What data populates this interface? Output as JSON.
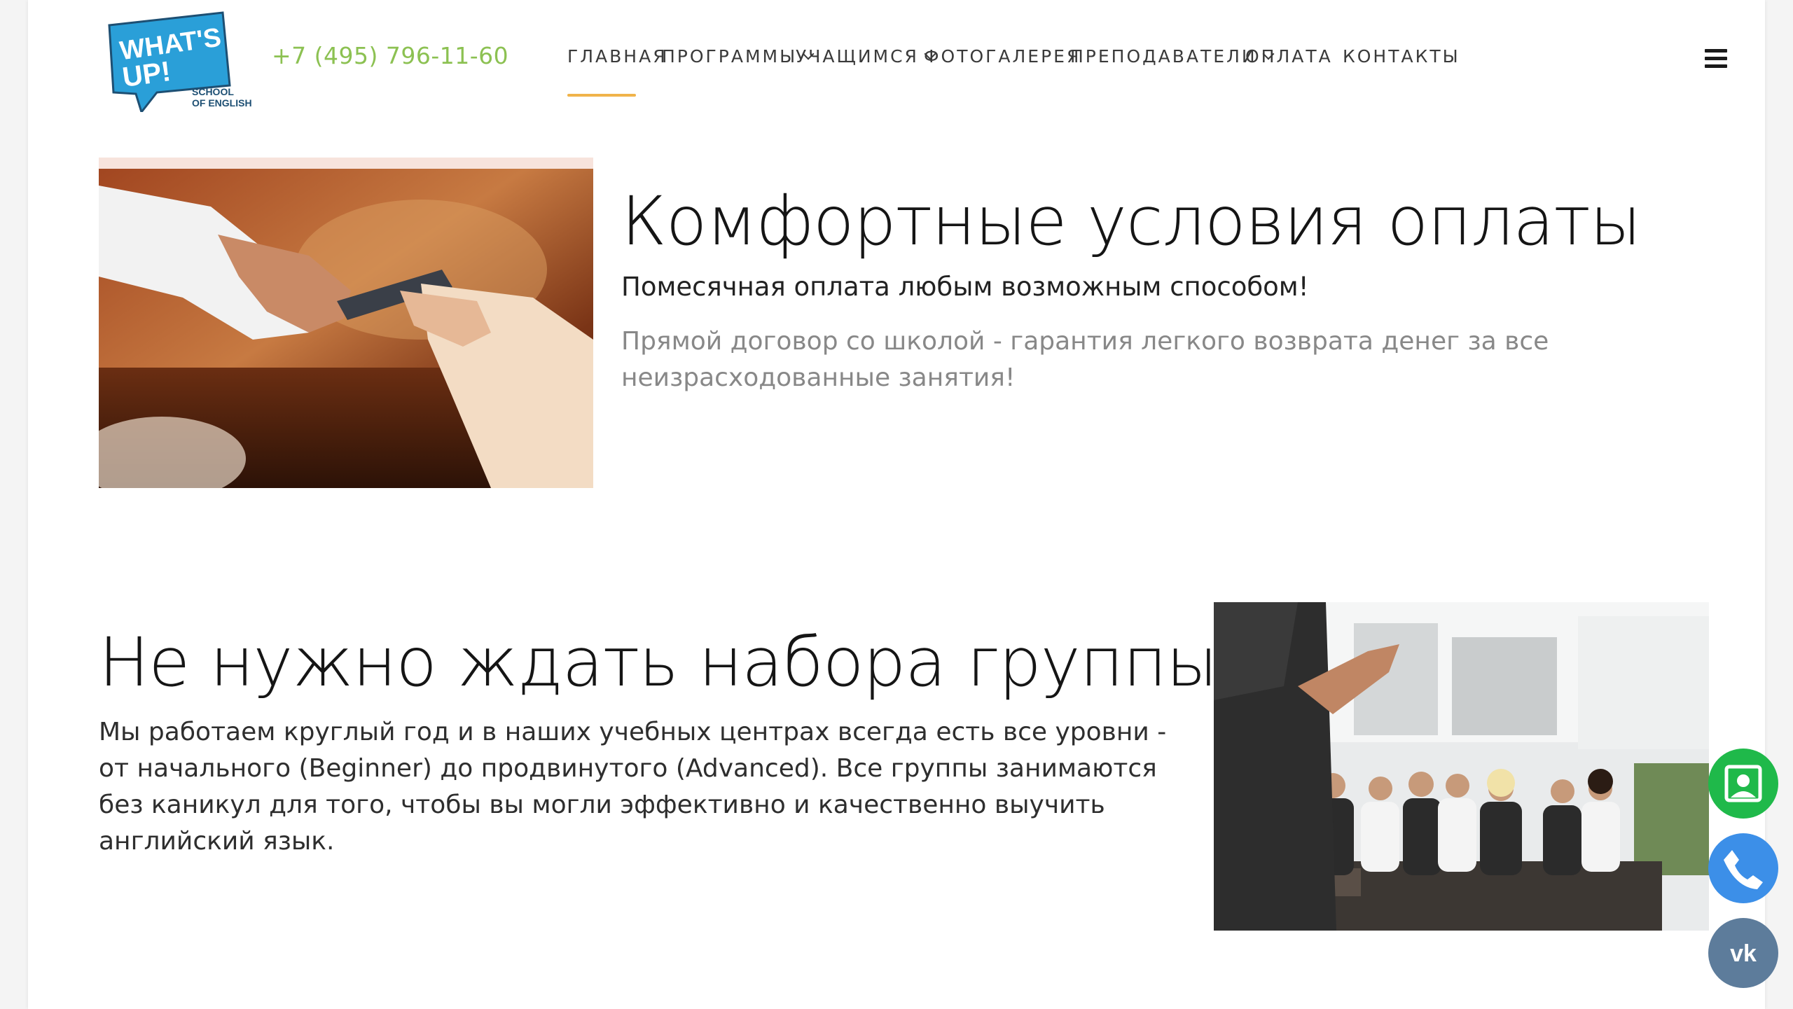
{
  "header": {
    "logo": {
      "line1": "WHAT'S",
      "line2": "UP!",
      "line3": "SCHOOL",
      "line4": "OF ENGLISH"
    },
    "phone": "+7 (495) 796-11-60",
    "nav": [
      {
        "label": "ГЛАВНАЯ",
        "has_dropdown": false,
        "active": true
      },
      {
        "label": "ПРОГРАММЫ",
        "has_dropdown": true,
        "active": false
      },
      {
        "label": "УЧАЩИМСЯ",
        "has_dropdown": true,
        "active": false
      },
      {
        "label": "ФОТОГАЛЕРЕЯ",
        "has_dropdown": false,
        "active": false
      },
      {
        "label": "ПРЕПОДАВАТЕЛИ",
        "has_dropdown": true,
        "active": false
      },
      {
        "label": "ОПЛАТА",
        "has_dropdown": false,
        "active": false
      },
      {
        "label": "КОНТАКТЫ",
        "has_dropdown": false,
        "active": false
      }
    ],
    "menu_icon": "hamburger-icon"
  },
  "payment_section": {
    "title": "Комфортные условия оплаты",
    "subtitle": "Помесячная оплата любым возможным способом!",
    "description": "Прямой договор со школой - гарантия легкого возврата денег за все неизрасходованные занятия!"
  },
  "group_section": {
    "title": "Не нужно ждать набора группы",
    "description": "Мы работаем круглый год и в наших учебных центрах всегда есть все уровни - от начального (Beginner) до продвинутого (Advanced). Все группы занимаются без каникул для того, чтобы вы могли эффективно и качественно выучить английский язык."
  },
  "floating_widgets": [
    {
      "name": "contact-card-icon",
      "color": "#1fb94a"
    },
    {
      "name": "phone-icon",
      "color": "#3c8fe8"
    },
    {
      "name": "vk-icon",
      "color": "#5d7c9b"
    }
  ],
  "colors": {
    "accent_green": "#8cc152",
    "nav_underline": "#f0b34a",
    "logo_blue": "#2a9fd8",
    "logo_dark": "#1d4f73"
  }
}
